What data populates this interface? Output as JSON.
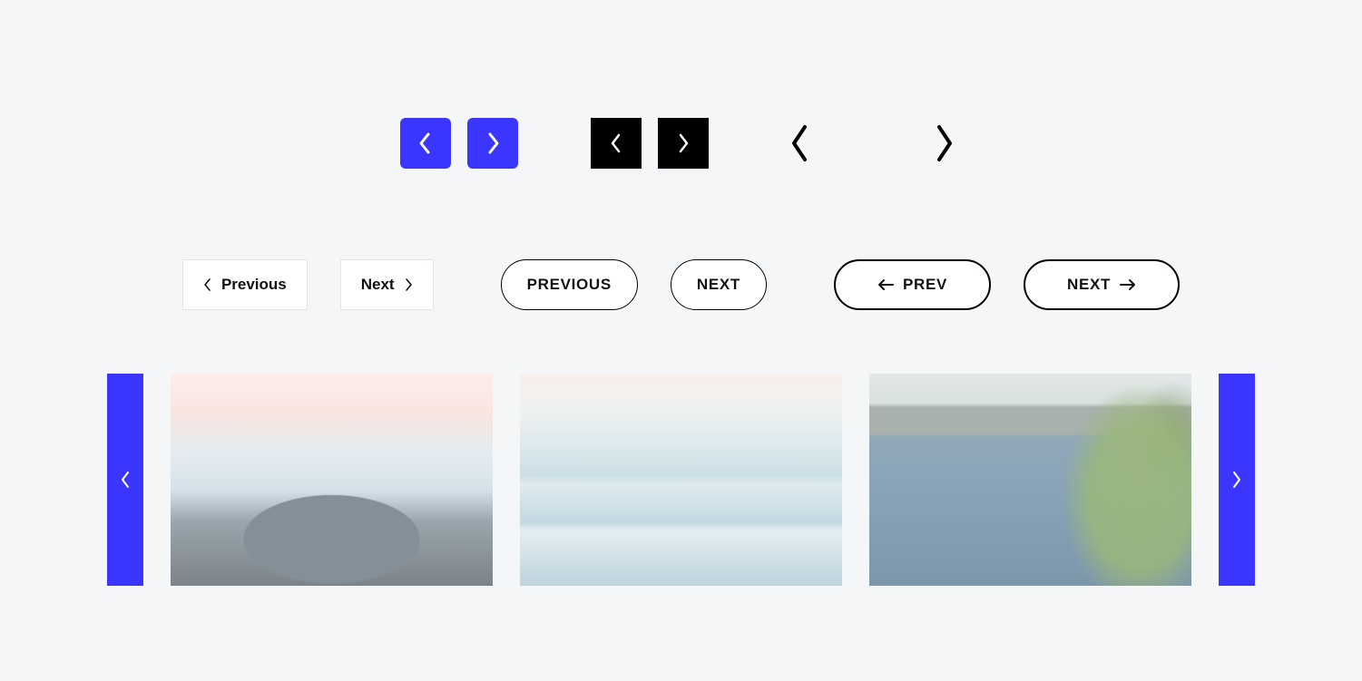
{
  "colors": {
    "accent_blue": "#3a36ff",
    "black": "#000000",
    "page_bg": "#f5f6f7"
  },
  "row2": {
    "rect_prev": "Previous",
    "rect_next": "Next",
    "pill_prev": "PREVIOUS",
    "pill_next": "NEXT",
    "thick_prev": "PREV",
    "thick_next": "NEXT"
  },
  "carousel": {
    "slides": [
      "mountain-sunset",
      "ocean-waves",
      "tropical-palm"
    ]
  }
}
